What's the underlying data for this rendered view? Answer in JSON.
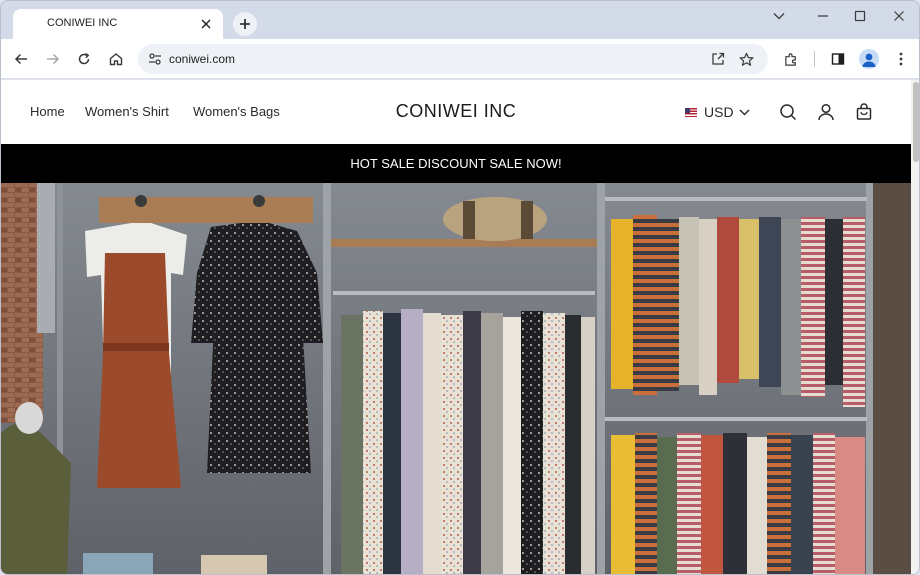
{
  "browser": {
    "tab_title": "CONIWEI INC",
    "url": "coniwei.com"
  },
  "site": {
    "nav": [
      "Home",
      "Women's Shirt",
      "Women's Bags"
    ],
    "brand": "CONIWEI INC",
    "currency": "USD",
    "announcement": "HOT SALE DISCOUNT SALE NOW!"
  },
  "colors": {
    "announcement_bg": "#000000",
    "announcement_fg": "#ffffff",
    "browser_frame": "#d3dbe9"
  },
  "hero": {
    "scene": "clothing-store-racks-photo"
  }
}
